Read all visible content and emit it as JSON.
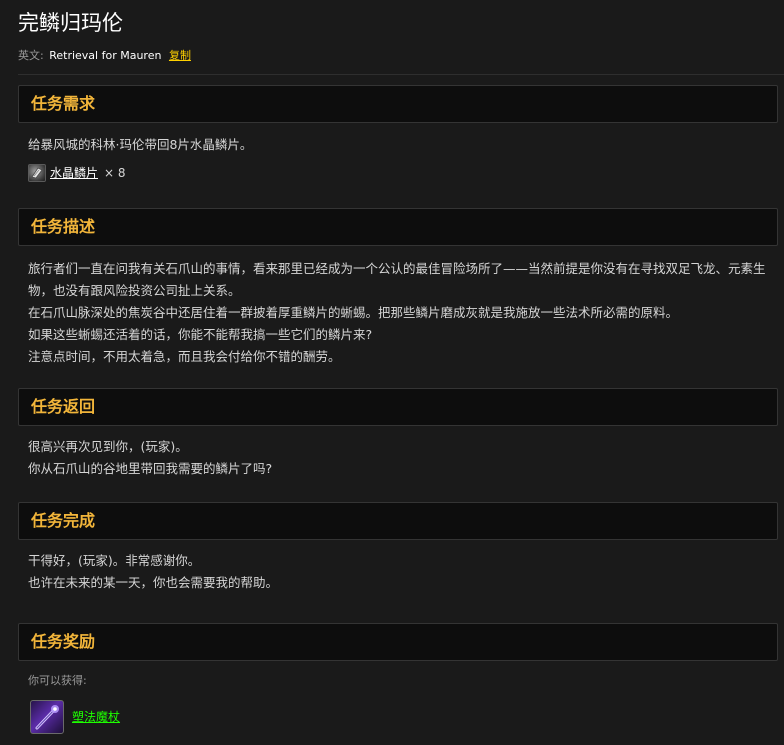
{
  "page": {
    "title": "完鳞归玛伦",
    "english_label": "英文:",
    "english_name": "Retrieval for Mauren",
    "copy_label": "复制"
  },
  "requirements": {
    "heading": "任务需求",
    "text": "给暴风城的科林·玛伦带回8片水晶鳞片。",
    "item": {
      "icon": "crystal-scale-icon",
      "name": "水晶鳞片",
      "quantity": "× 8"
    }
  },
  "description": {
    "heading": "任务描述",
    "paragraphs": [
      "旅行者们一直在问我有关石爪山的事情，看来那里已经成为一个公认的最佳冒险场所了——当然前提是你没有在寻找双足飞龙、元素生物，也没有跟风险投资公司扯上关系。",
      "在石爪山脉深处的焦炭谷中还居住着一群披着厚重鳞片的蜥蜴。把那些鳞片磨成灰就是我施放一些法术所必需的原料。",
      "如果这些蜥蜴还活着的话，你能不能帮我搞一些它们的鳞片来?",
      "注意点时间，不用太着急，而且我会付给你不错的酬劳。"
    ]
  },
  "progress": {
    "heading": "任务返回",
    "paragraphs": [
      "很高兴再次见到你，(玩家)。",
      "你从石爪山的谷地里带回我需要的鳞片了吗?"
    ]
  },
  "completion": {
    "heading": "任务完成",
    "paragraphs": [
      "干得好，(玩家)。非常感谢你。",
      "也许在未来的某一天，你也会需要我的帮助。"
    ]
  },
  "rewards": {
    "heading": "任务奖励",
    "label": "你可以获得:",
    "item": {
      "icon": "spellbound-wand-icon",
      "name": "塑法魔杖"
    }
  },
  "colors": {
    "heading": "#f2b53a",
    "copy_link": "#ffd100",
    "reward_item": "#1eff00",
    "background": "#1a1a1a",
    "header_bg": "#0d0d0d"
  }
}
